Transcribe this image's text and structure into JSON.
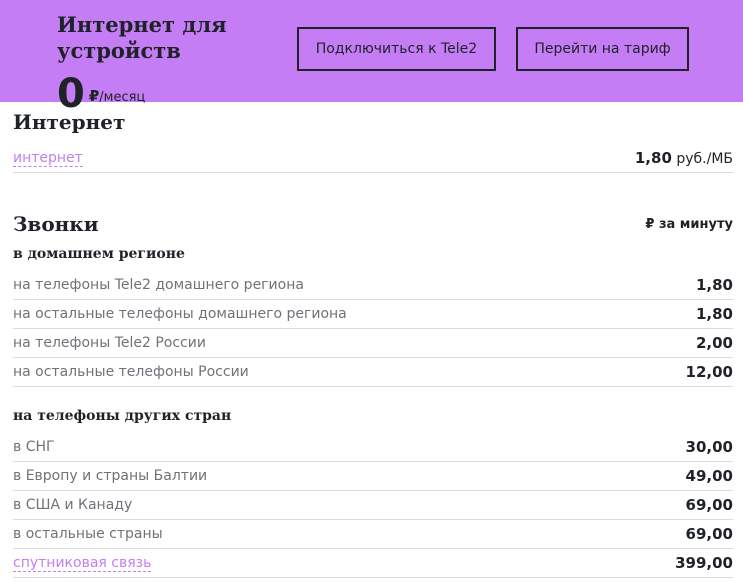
{
  "header": {
    "title": "Интернет для устройств",
    "price_value": "0",
    "price_currency": "₽",
    "price_period": "/месяц",
    "connect_button": "Подключиться к Tele2",
    "switch_button": "Перейти на тариф",
    "background_color": "#c47df4"
  },
  "internet": {
    "heading": "Интернет",
    "row": {
      "label": "интернет",
      "price": "1,80",
      "unit": "руб./МБ"
    }
  },
  "calls": {
    "heading": "Звонки",
    "unit": "₽ за минуту",
    "home_region": {
      "heading": "в домашнем регионе",
      "rows": [
        {
          "label": "на телефоны Tele2 домашнего региона",
          "value": "1,80"
        },
        {
          "label": "на остальные телефоны домашнего региона",
          "value": "1,80"
        },
        {
          "label": "на телефоны Tele2 России",
          "value": "2,00"
        },
        {
          "label": "на остальные телефоны России",
          "value": "12,00"
        }
      ]
    },
    "other_countries": {
      "heading": "на телефоны других стран",
      "rows": [
        {
          "label": "в СНГ",
          "value": "30,00"
        },
        {
          "label": "в Европу и страны Балтии",
          "value": "49,00"
        },
        {
          "label": "в США и Канаду",
          "value": "69,00"
        },
        {
          "label": "в остальные страны",
          "value": "69,00"
        },
        {
          "label": "спутниковая связь",
          "value": "399,00",
          "is_link": true
        }
      ]
    }
  }
}
